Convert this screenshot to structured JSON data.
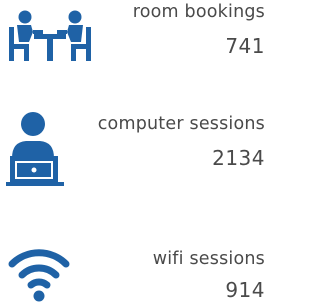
{
  "stats": [
    {
      "label": "room bookings",
      "value": "741",
      "icon": "meeting-table-icon"
    },
    {
      "label": "computer sessions",
      "value": "2134",
      "icon": "computer-user-icon"
    },
    {
      "label": "wifi sessions",
      "value": "914",
      "icon": "wifi-icon"
    }
  ],
  "colors": {
    "icon": "#1f62a6",
    "text": "#4a4a4a"
  }
}
